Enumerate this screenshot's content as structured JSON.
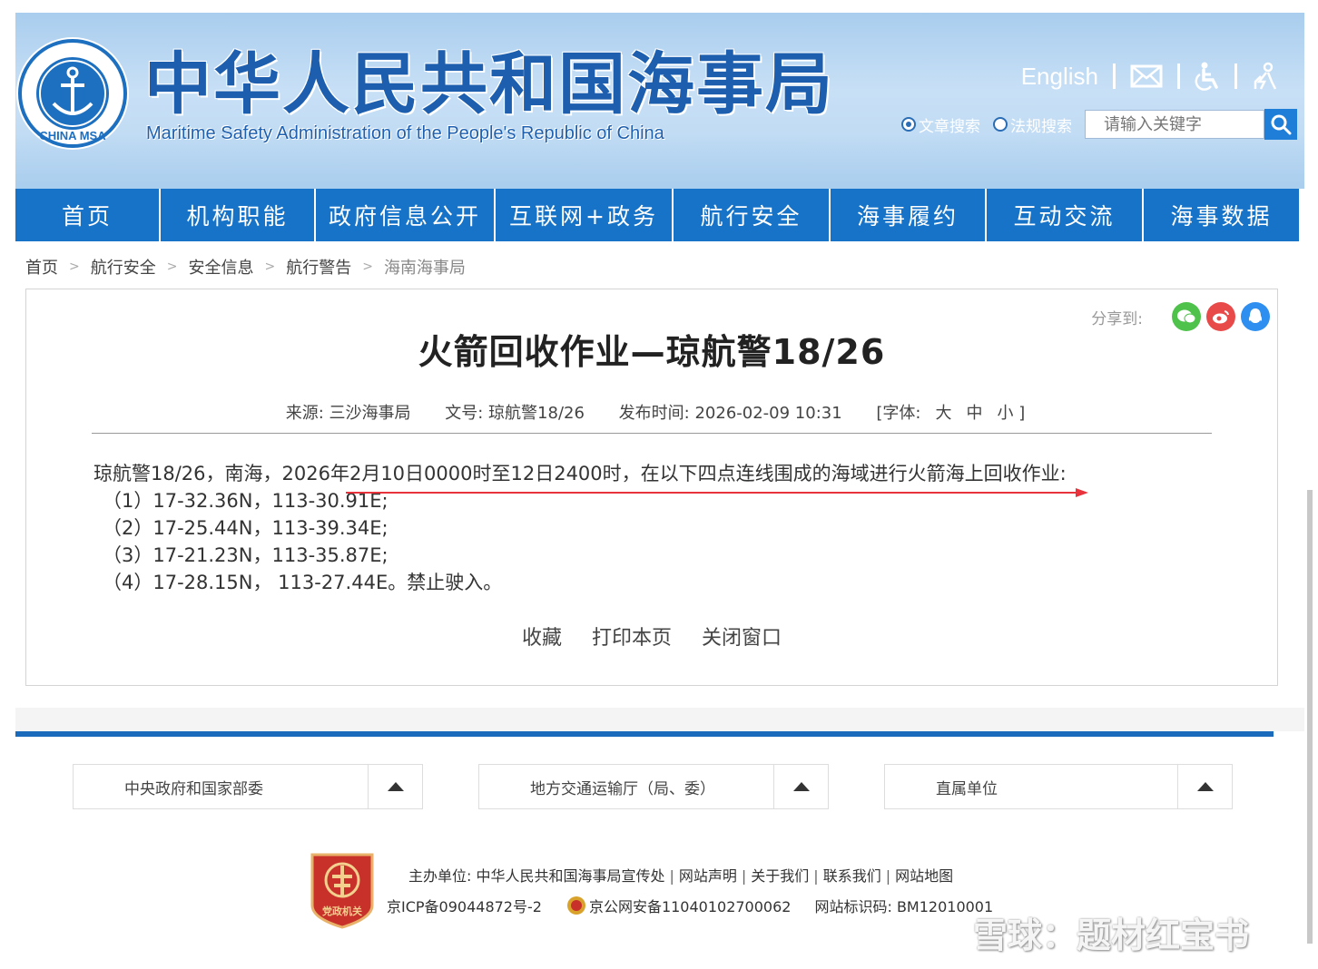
{
  "header": {
    "site_title": "中华人民共和国海事局",
    "site_subtitle": "Maritime Safety Administration of the People's Republic of China",
    "logo_text": "CHINA MSA",
    "toplinks": {
      "english": "English"
    },
    "search": {
      "radio_article": "文章搜索",
      "radio_law": "法规搜索",
      "placeholder": "请输入关键字"
    }
  },
  "nav": {
    "items": [
      {
        "label": "首页"
      },
      {
        "label": "机构职能"
      },
      {
        "label": "政府信息公开"
      },
      {
        "label": "互联网+政务"
      },
      {
        "label": "航行安全"
      },
      {
        "label": "海事履约"
      },
      {
        "label": "互动交流"
      },
      {
        "label": "海事数据"
      }
    ]
  },
  "breadcrumb": {
    "items": [
      "首页",
      "航行安全",
      "安全信息",
      "航行警告",
      "海南海事局"
    ],
    "separator": ">"
  },
  "article": {
    "share_label": "分享到:",
    "title": "火箭回收作业—琼航警18/26",
    "meta": {
      "source": "来源: 三沙海事局",
      "doc_no": "文号: 琼航警18/26",
      "publish_time": "发布时间: 2026-02-09 10:31",
      "font_label": "[字体:",
      "font_large": "大",
      "font_medium": "中",
      "font_small": "小 ]"
    },
    "body": {
      "intro": "琼航警18/26，南海，2026年2月10日0000时至12日2400时，在以下四点连线围成的海域进行火箭海上回收作业:",
      "points": [
        "（1）17-32.36N，113-30.91E;",
        "（2）17-25.44N，113-39.34E;",
        "（3）17-21.23N，113-35.87E;",
        "（4）17-28.15N， 113-27.44E。禁止驶入。"
      ]
    },
    "actions": {
      "favorite": "收藏",
      "print": "打印本页",
      "close": "关闭窗口"
    }
  },
  "footer": {
    "dropdowns": [
      {
        "label": "中央政府和国家部委"
      },
      {
        "label": "地方交通运输厅（局、委）"
      },
      {
        "label": "直属单位"
      }
    ],
    "badge_text": "党政机关",
    "host_label": "主办单位: 中华人民共和国海事局宣传处",
    "links": [
      "网站声明",
      "关于我们",
      "联系我们",
      "网站地图"
    ],
    "icp": "京ICP备09044872号-2",
    "police": "京公网安备11040102700062",
    "site_id": "网站标识码: BM12010001",
    "watermark": "雪球：题材红宝书"
  },
  "colors": {
    "nav_blue": "#1673c8",
    "title_blue": "#1d5fae",
    "annotation_red": "#e8323c"
  }
}
